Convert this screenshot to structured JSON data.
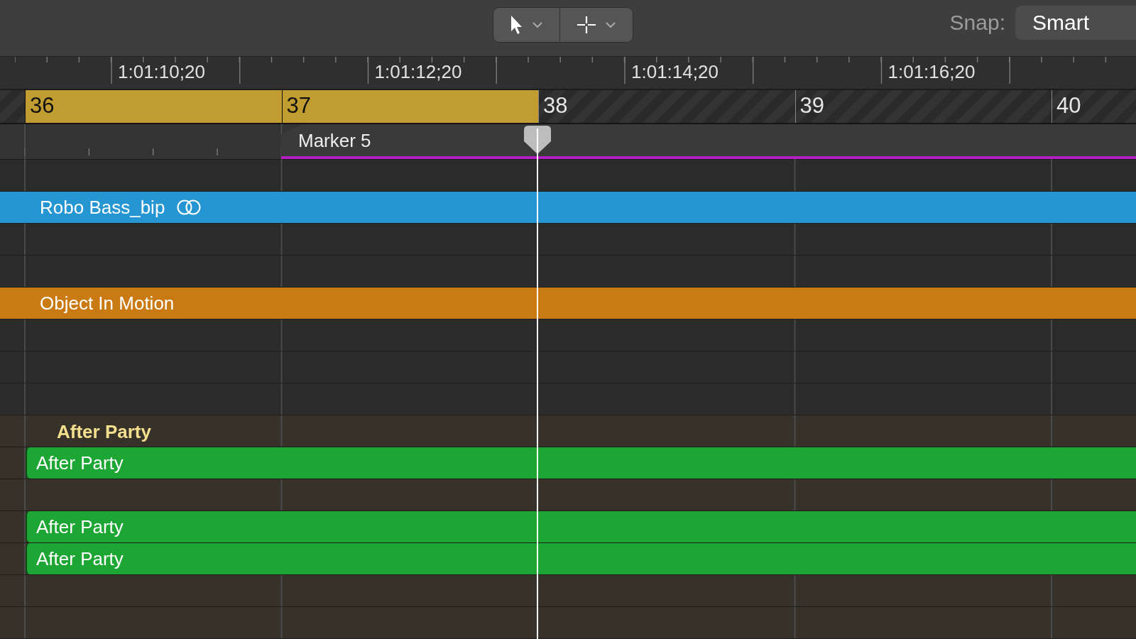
{
  "toolbar": {
    "snap_label": "Snap:",
    "snap_value": "Smart"
  },
  "timecodes": [
    "1:01:10;20",
    "1:01:12;20",
    "1:01:14;20",
    "1:01:16;20"
  ],
  "bars": [
    {
      "number": "36",
      "in_cycle": true
    },
    {
      "number": "37",
      "in_cycle": true
    },
    {
      "number": "38",
      "in_cycle": false
    },
    {
      "number": "39",
      "in_cycle": false
    },
    {
      "number": "40",
      "in_cycle": false
    }
  ],
  "marker": {
    "label": "Marker 5",
    "color": "#b21fc0"
  },
  "tracks": [
    {
      "kind": "empty"
    },
    {
      "kind": "region",
      "name": "Robo Bass_bip",
      "color": "#2596d2",
      "looped": true,
      "clipped_left": true
    },
    {
      "kind": "empty"
    },
    {
      "kind": "empty"
    },
    {
      "kind": "region",
      "name": "Object In Motion",
      "color": "#c97a12",
      "looped": false,
      "clipped_left": true
    },
    {
      "kind": "empty"
    },
    {
      "kind": "empty"
    },
    {
      "kind": "empty"
    }
  ],
  "folder": {
    "title": "After Party",
    "tracks": [
      {
        "kind": "region",
        "name": "After Party",
        "color": "#1da634",
        "looped": false,
        "clipped_left": false
      },
      {
        "kind": "empty"
      },
      {
        "kind": "region",
        "name": "After Party",
        "color": "#1da634",
        "looped": false,
        "clipped_left": false
      },
      {
        "kind": "region",
        "name": "After Party",
        "color": "#1da634",
        "looped": false,
        "clipped_left": false
      },
      {
        "kind": "empty"
      },
      {
        "kind": "empty"
      }
    ]
  }
}
